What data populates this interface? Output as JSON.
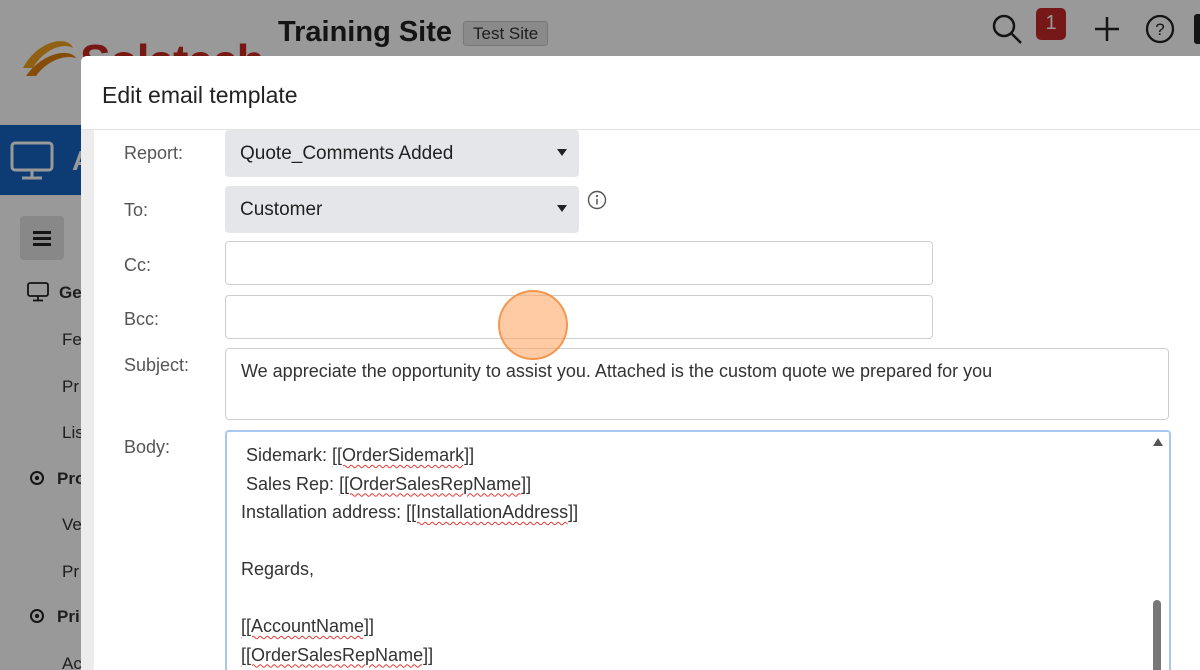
{
  "app": {
    "logo_text": "Solatech",
    "site_title": "Training Site",
    "site_badge": "Test Site",
    "notification_count": "1",
    "sidebar": {
      "items": [
        {
          "label": "Ge",
          "bold": true
        },
        {
          "label": "Fe",
          "bold": false
        },
        {
          "label": "Pr",
          "bold": false
        },
        {
          "label": "Lis",
          "bold": false
        },
        {
          "label": "Pro",
          "bold": true
        },
        {
          "label": "Ve",
          "bold": false
        },
        {
          "label": "Pr",
          "bold": false
        },
        {
          "label": "Pri",
          "bold": true
        },
        {
          "label": "Ac",
          "bold": false
        }
      ],
      "nav_letter": "A"
    }
  },
  "modal": {
    "title": "Edit email template",
    "fields": {
      "report_label": "Report:",
      "report_value": "Quote_Comments Added",
      "to_label": "To:",
      "to_value": "Customer",
      "cc_label": "Cc:",
      "bcc_label": "Bcc:",
      "subject_label": "Subject:",
      "subject_value": "We appreciate the opportunity to assist you. Attached is the custom quote we prepared for you",
      "body_label": "Body:"
    },
    "body_lines": [
      {
        "prefix": " Sidemark: ",
        "token": "[[OrderSidemark]]"
      },
      {
        "prefix": " Sales Rep: ",
        "token": "[[OrderSalesRepName]]"
      },
      {
        "prefix": "Installation address: ",
        "token": "[[InstallationAddress]]"
      },
      {
        "prefix": "",
        "token": ""
      },
      {
        "prefix": "Regards,",
        "token": ""
      },
      {
        "prefix": "",
        "token": ""
      },
      {
        "prefix": "",
        "token": "[[AccountName]]"
      },
      {
        "prefix": "",
        "token": "[[OrderSalesRepName]]"
      }
    ]
  }
}
